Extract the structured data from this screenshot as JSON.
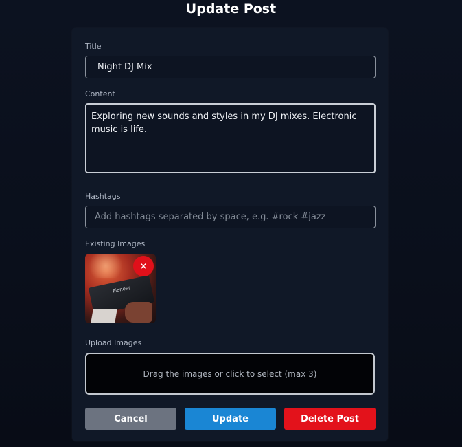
{
  "page": {
    "title": "Update Post"
  },
  "form": {
    "title_label": "Title",
    "title_value": "Night DJ Mix",
    "content_label": "Content",
    "content_value": "Exploring new sounds and styles in my DJ mixes. Electronic music is life.",
    "hashtags_label": "Hashtags",
    "hashtags_placeholder": "Add hashtags separated by space, e.g. #rock #jazz",
    "existing_images_label": "Existing Images",
    "remove_image_symbol": "✕",
    "upload_images_label": "Upload Images",
    "dropzone_text": "Drag the images or click to select (max 3)"
  },
  "thumbnail": {
    "brand_text": "Pioneer"
  },
  "actions": {
    "cancel_label": "Cancel",
    "update_label": "Update",
    "delete_label": "Delete Post"
  },
  "colors": {
    "background": "#0a0f1b",
    "card": "#101827",
    "update": "#1a86d4",
    "delete": "#e3121b",
    "cancel": "#6c7380"
  }
}
